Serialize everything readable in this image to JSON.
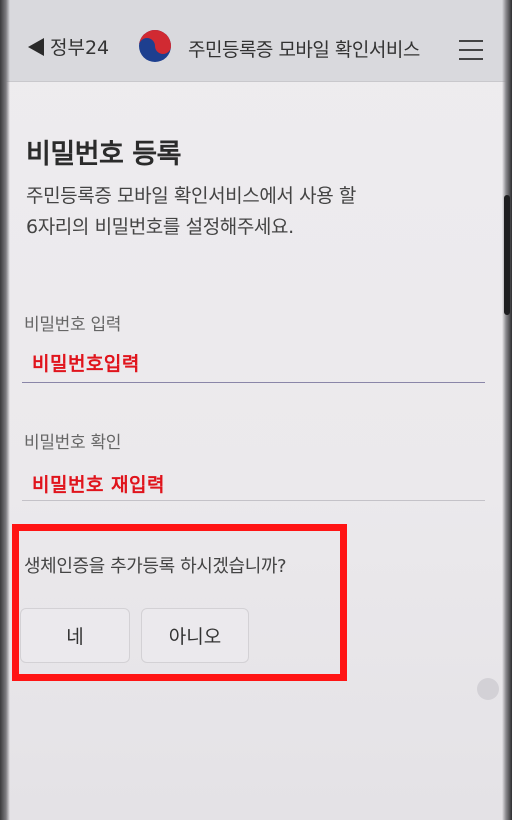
{
  "header": {
    "back_label": "정부24",
    "title": "주민등록증 모바일 확인서비스"
  },
  "page": {
    "title": "비밀번호 등록",
    "description_line1": "주민등록증 모바일 확인서비스에서 사용 할",
    "description_line2": "6자리의 비밀번호를 설정해주세요."
  },
  "fields": {
    "password": {
      "label": "비밀번호 입력",
      "value": "비밀번호입력"
    },
    "confirm": {
      "label": "비밀번호 확인",
      "value": "비밀번호 재입력"
    }
  },
  "biometric": {
    "question": "생체인증을 추가등록 하시겠습니까?",
    "yes_label": "네",
    "no_label": "아니오"
  },
  "colors": {
    "accent_red": "#ff1414",
    "field_text_red": "#e0141c",
    "underline": "#8a86a8"
  }
}
